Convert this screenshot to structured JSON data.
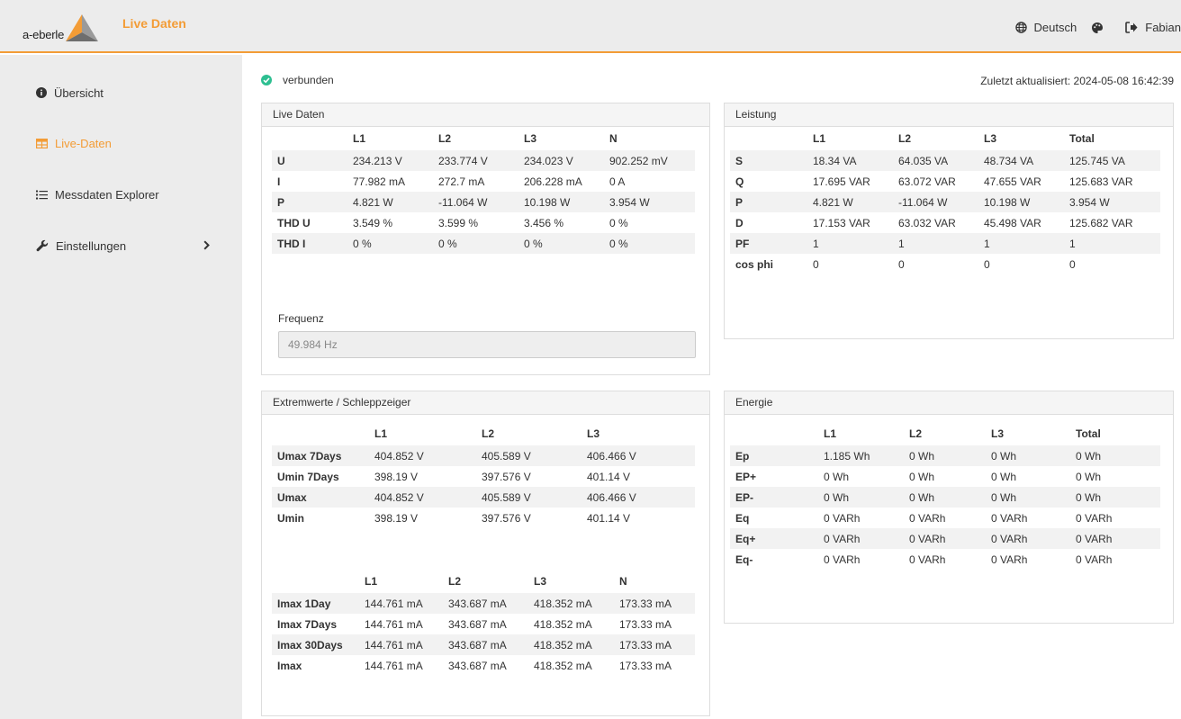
{
  "header": {
    "logo_text": "a-eberle",
    "app_title": "Live Daten",
    "language": "Deutsch",
    "user": "Fabian"
  },
  "sidebar": {
    "items": [
      {
        "label": "Übersicht",
        "icon": "info-circle-icon"
      },
      {
        "label": "Live-Daten",
        "icon": "table-icon",
        "active": true
      },
      {
        "label": "Messdaten Explorer",
        "icon": "list-icon"
      },
      {
        "label": "Einstellungen",
        "icon": "wrench-icon",
        "has_submenu": true
      }
    ]
  },
  "status": {
    "text": "verbunden",
    "last_updated": "Zuletzt aktualisiert: 2024-05-08 16:42:39"
  },
  "colors": {
    "accent": "#f39c36",
    "connected": "#2ebf91"
  },
  "live": {
    "title": "Live Daten",
    "headers": [
      "",
      "L1",
      "L2",
      "L3",
      "N"
    ],
    "rows": [
      [
        "U",
        "234.213 V",
        "233.774 V",
        "234.023 V",
        "902.252 mV"
      ],
      [
        "I",
        "77.982 mA",
        "272.7 mA",
        "206.228 mA",
        "0 A"
      ],
      [
        "P",
        "4.821 W",
        "-11.064 W",
        "10.198 W",
        "3.954 W"
      ],
      [
        "THD U",
        "3.549 %",
        "3.599 %",
        "3.456 %",
        "0 %"
      ],
      [
        "THD I",
        "0 %",
        "0 %",
        "0 %",
        "0 %"
      ]
    ],
    "freq_label": "Frequenz",
    "freq_value": "49.984 Hz"
  },
  "leistung": {
    "title": "Leistung",
    "headers": [
      "",
      "L1",
      "L2",
      "L3",
      "Total"
    ],
    "rows": [
      [
        "S",
        "18.34 VA",
        "64.035 VA",
        "48.734 VA",
        "125.745 VA"
      ],
      [
        "Q",
        "17.695 VAR",
        "63.072 VAR",
        "47.655 VAR",
        "125.683 VAR"
      ],
      [
        "P",
        "4.821 W",
        "-11.064 W",
        "10.198 W",
        "3.954 W"
      ],
      [
        "D",
        "17.153 VAR",
        "63.032 VAR",
        "45.498 VAR",
        "125.682 VAR"
      ],
      [
        "PF",
        "1",
        "1",
        "1",
        "1"
      ],
      [
        "cos phi",
        "0",
        "0",
        "0",
        "0"
      ]
    ]
  },
  "extrem": {
    "title": "Extremwerte / Schleppzeiger",
    "u_headers": [
      "",
      "L1",
      "L2",
      "L3"
    ],
    "u_rows": [
      [
        "Umax 7Days",
        "404.852 V",
        "405.589 V",
        "406.466 V"
      ],
      [
        "Umin 7Days",
        "398.19 V",
        "397.576 V",
        "401.14 V"
      ],
      [
        "Umax",
        "404.852 V",
        "405.589 V",
        "406.466 V"
      ],
      [
        "Umin",
        "398.19 V",
        "397.576 V",
        "401.14 V"
      ]
    ],
    "i_headers": [
      "",
      "L1",
      "L2",
      "L3",
      "N"
    ],
    "i_rows": [
      [
        "Imax 1Day",
        "144.761 mA",
        "343.687 mA",
        "418.352 mA",
        "173.33 mA"
      ],
      [
        "Imax 7Days",
        "144.761 mA",
        "343.687 mA",
        "418.352 mA",
        "173.33 mA"
      ],
      [
        "Imax 30Days",
        "144.761 mA",
        "343.687 mA",
        "418.352 mA",
        "173.33 mA"
      ],
      [
        "Imax",
        "144.761 mA",
        "343.687 mA",
        "418.352 mA",
        "173.33 mA"
      ]
    ]
  },
  "energie": {
    "title": "Energie",
    "headers": [
      "",
      "L1",
      "L2",
      "L3",
      "Total"
    ],
    "rows": [
      [
        "Ep",
        "1.185 Wh",
        "0 Wh",
        "0 Wh",
        "0 Wh"
      ],
      [
        "EP+",
        "0 Wh",
        "0 Wh",
        "0 Wh",
        "0 Wh"
      ],
      [
        "EP-",
        "0 Wh",
        "0 Wh",
        "0 Wh",
        "0 Wh"
      ],
      [
        "Eq",
        "0 VARh",
        "0 VARh",
        "0 VARh",
        "0 VARh"
      ],
      [
        "Eq+",
        "0 VARh",
        "0 VARh",
        "0 VARh",
        "0 VARh"
      ],
      [
        "Eq-",
        "0 VARh",
        "0 VARh",
        "0 VARh",
        "0 VARh"
      ]
    ]
  }
}
